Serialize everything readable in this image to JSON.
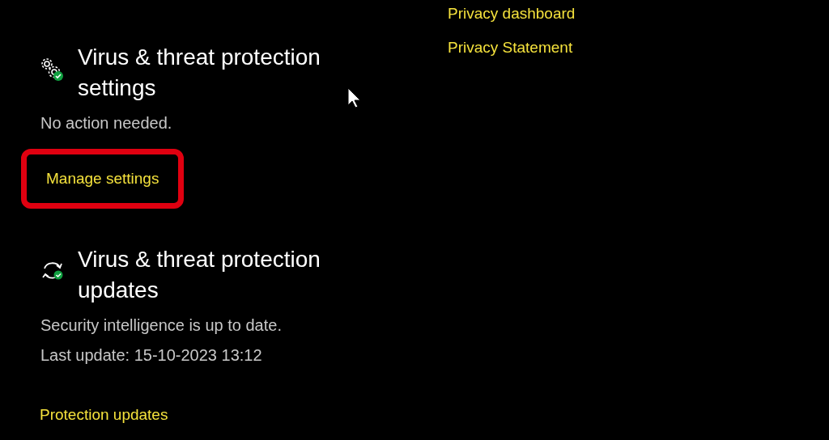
{
  "sections": [
    {
      "kind": "gears",
      "title": "Virus & threat protection settings",
      "lines": [
        "No action needed."
      ],
      "link": {
        "label": "Manage settings",
        "highlighted": true
      }
    },
    {
      "kind": "sync",
      "title": "Virus & threat protection updates",
      "lines": [
        "Security intelligence is up to date.",
        "Last update: 15-10-2023 13:12"
      ],
      "link": {
        "label": "Protection updates",
        "highlighted": false
      }
    }
  ],
  "side_links": [
    "Privacy dashboard",
    "Privacy Statement"
  ]
}
